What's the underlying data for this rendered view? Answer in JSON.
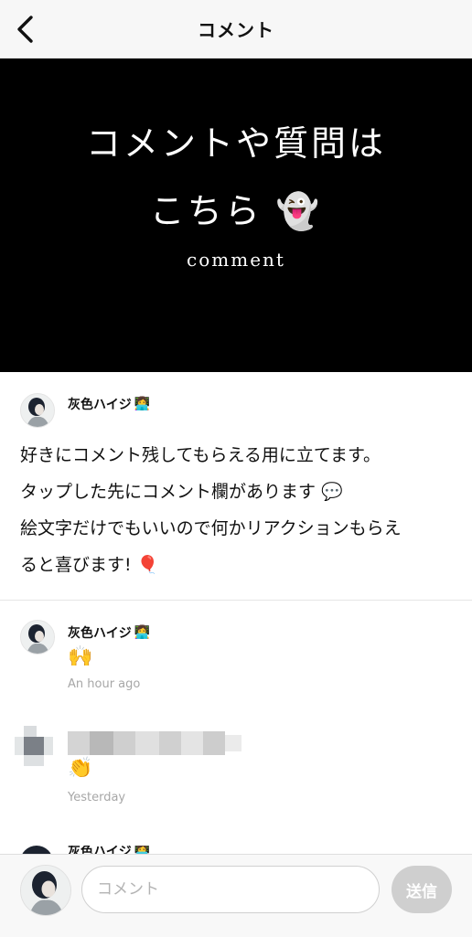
{
  "header": {
    "title": "コメント"
  },
  "hero": {
    "line1": "コメントや質問は",
    "line2": "こちら 👻",
    "sub": "comment"
  },
  "post": {
    "author": "灰色ハイジ",
    "author_badge": "👩‍💻",
    "body": "好きにコメント残してもらえる用に立てます。\nタップした先にコメント欄があります 💬\n絵文字だけでもいいので何かリアクションもらえ\nると喜びます! 🎈"
  },
  "comments": [
    {
      "author": "灰色ハイジ",
      "author_badge": "👩‍💻",
      "text": "🙌",
      "time": "An hour ago"
    },
    {
      "author": "",
      "text": "👏",
      "time": "Yesterday"
    },
    {
      "author": "灰色ハイジ",
      "author_badge": "👩‍💻"
    }
  ],
  "composer": {
    "placeholder": "コメント",
    "send_label": "送信"
  },
  "colors": {
    "hero_bg": "#000000",
    "send_disabled": "#cfcfcf"
  }
}
